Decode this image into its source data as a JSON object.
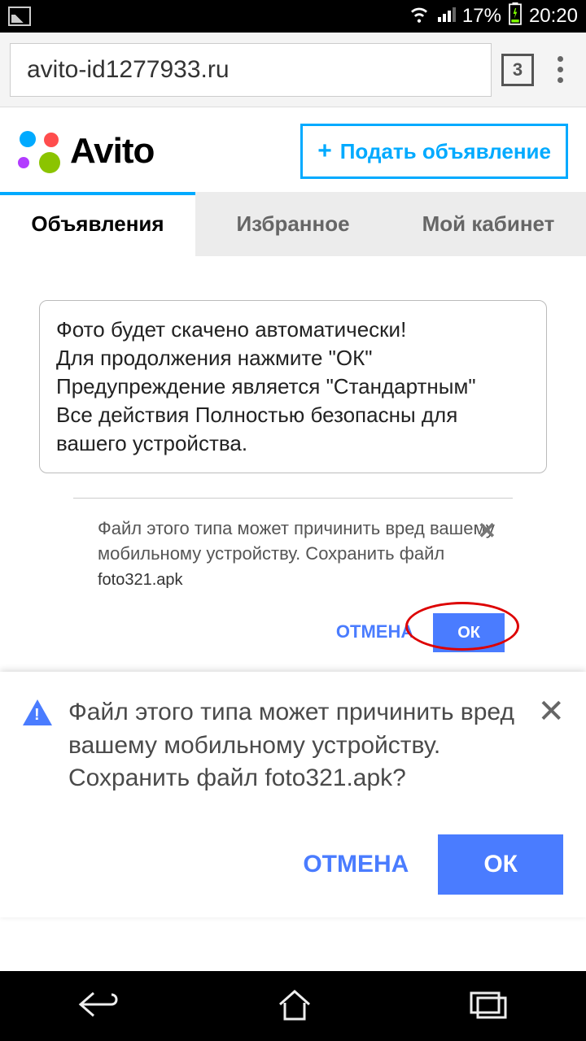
{
  "status": {
    "battery": "17%",
    "time": "20:20"
  },
  "browser": {
    "url": "avito-id1277933.ru",
    "tab_count": "3"
  },
  "avito": {
    "brand": "Avito",
    "post_button": "Подать объявление"
  },
  "tabs": {
    "listings": "Объявления",
    "favorites": "Избранное",
    "cabinet": "Мой кабинет"
  },
  "info_box": {
    "line1": "Фото будет скачено автоматически!",
    "line2": "Для продолжения нажмите \"ОК\"",
    "line3": "Предупреждение является \"Стандартным\"",
    "line4": "Все действия Полностью безопасны для вашего устройства."
  },
  "dl_card": {
    "text": "Файл этого типа может причинить вред вашему мобильному устройству. Сохранить файл",
    "filename": "foto321.apk",
    "cancel": "ОТМЕНА",
    "ok": "ОК"
  },
  "dialog": {
    "text": "Файл этого типа может причинить вред вашему мобильному устройству. Сохранить файл foto321.apk?",
    "cancel": "ОТМЕНА",
    "ok": "ОК"
  }
}
